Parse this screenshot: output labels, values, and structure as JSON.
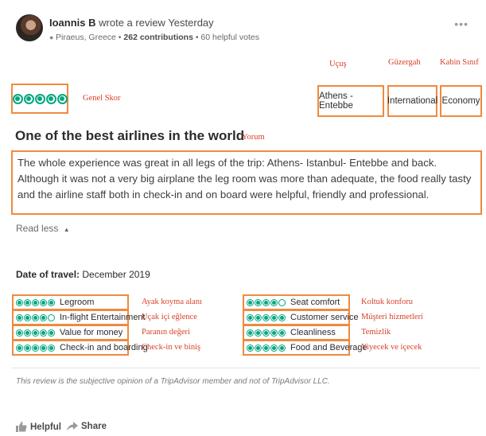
{
  "review": {
    "reviewer_name": "Ioannis B",
    "action_text": "wrote a review Yesterday",
    "location": "Piraeus, Greece",
    "contributions": "262 contributions",
    "helpful_votes": "60 helpful votes",
    "more_glyph": "•••",
    "overall_rating": 5,
    "route": "Athens - Entebbe",
    "region": "International",
    "cabin": "Economy",
    "title": "One of the best airlines in the world",
    "body": "The whole experience was great in all legs of the trip: Athens- Istanbul- Entebbe and back. Although it was not a very big airplane the leg room was more than adequate, the food really tasty and the airline staff both in check-in and on board were helpful, friendly and professional.",
    "read_less": "Read less",
    "date_label": "Date of travel:",
    "date_value": "December 2019",
    "ratings_left": [
      {
        "label": "Legroom",
        "score": 5
      },
      {
        "label": "In-flight Entertainment",
        "score": 4
      },
      {
        "label": "Value for money",
        "score": 5
      },
      {
        "label": "Check-in and boarding",
        "score": 5
      }
    ],
    "ratings_right": [
      {
        "label": "Seat comfort",
        "score": 4
      },
      {
        "label": "Customer service",
        "score": 5
      },
      {
        "label": "Cleanliness",
        "score": 5
      },
      {
        "label": "Food and Beverage",
        "score": 5
      }
    ],
    "disclaimer": "This review is the subjective opinion of a TripAdvisor member and not of TripAdvisor LLC.",
    "helpful_label": "Helpful",
    "share_label": "Share"
  },
  "annotations": {
    "genel_skor": "Genel Skor",
    "ucus": "Uçuş",
    "guzergah": "Güzergah",
    "kabin_sinif": "Kabin Sınıf",
    "yorum": "Yorum",
    "left": [
      "Ayak koyma alanı",
      "Uçak içi eğlence",
      "Paranın değeri",
      "Check-in ve biniş"
    ],
    "right": [
      "Koltuk konforu",
      "Müşteri hizmetleri",
      "Temizlik",
      "Yiyecek ve içecek"
    ]
  },
  "colors": {
    "bubble": "#00a680",
    "highlight": "#f08a3e",
    "annotation": "#d9402a"
  }
}
